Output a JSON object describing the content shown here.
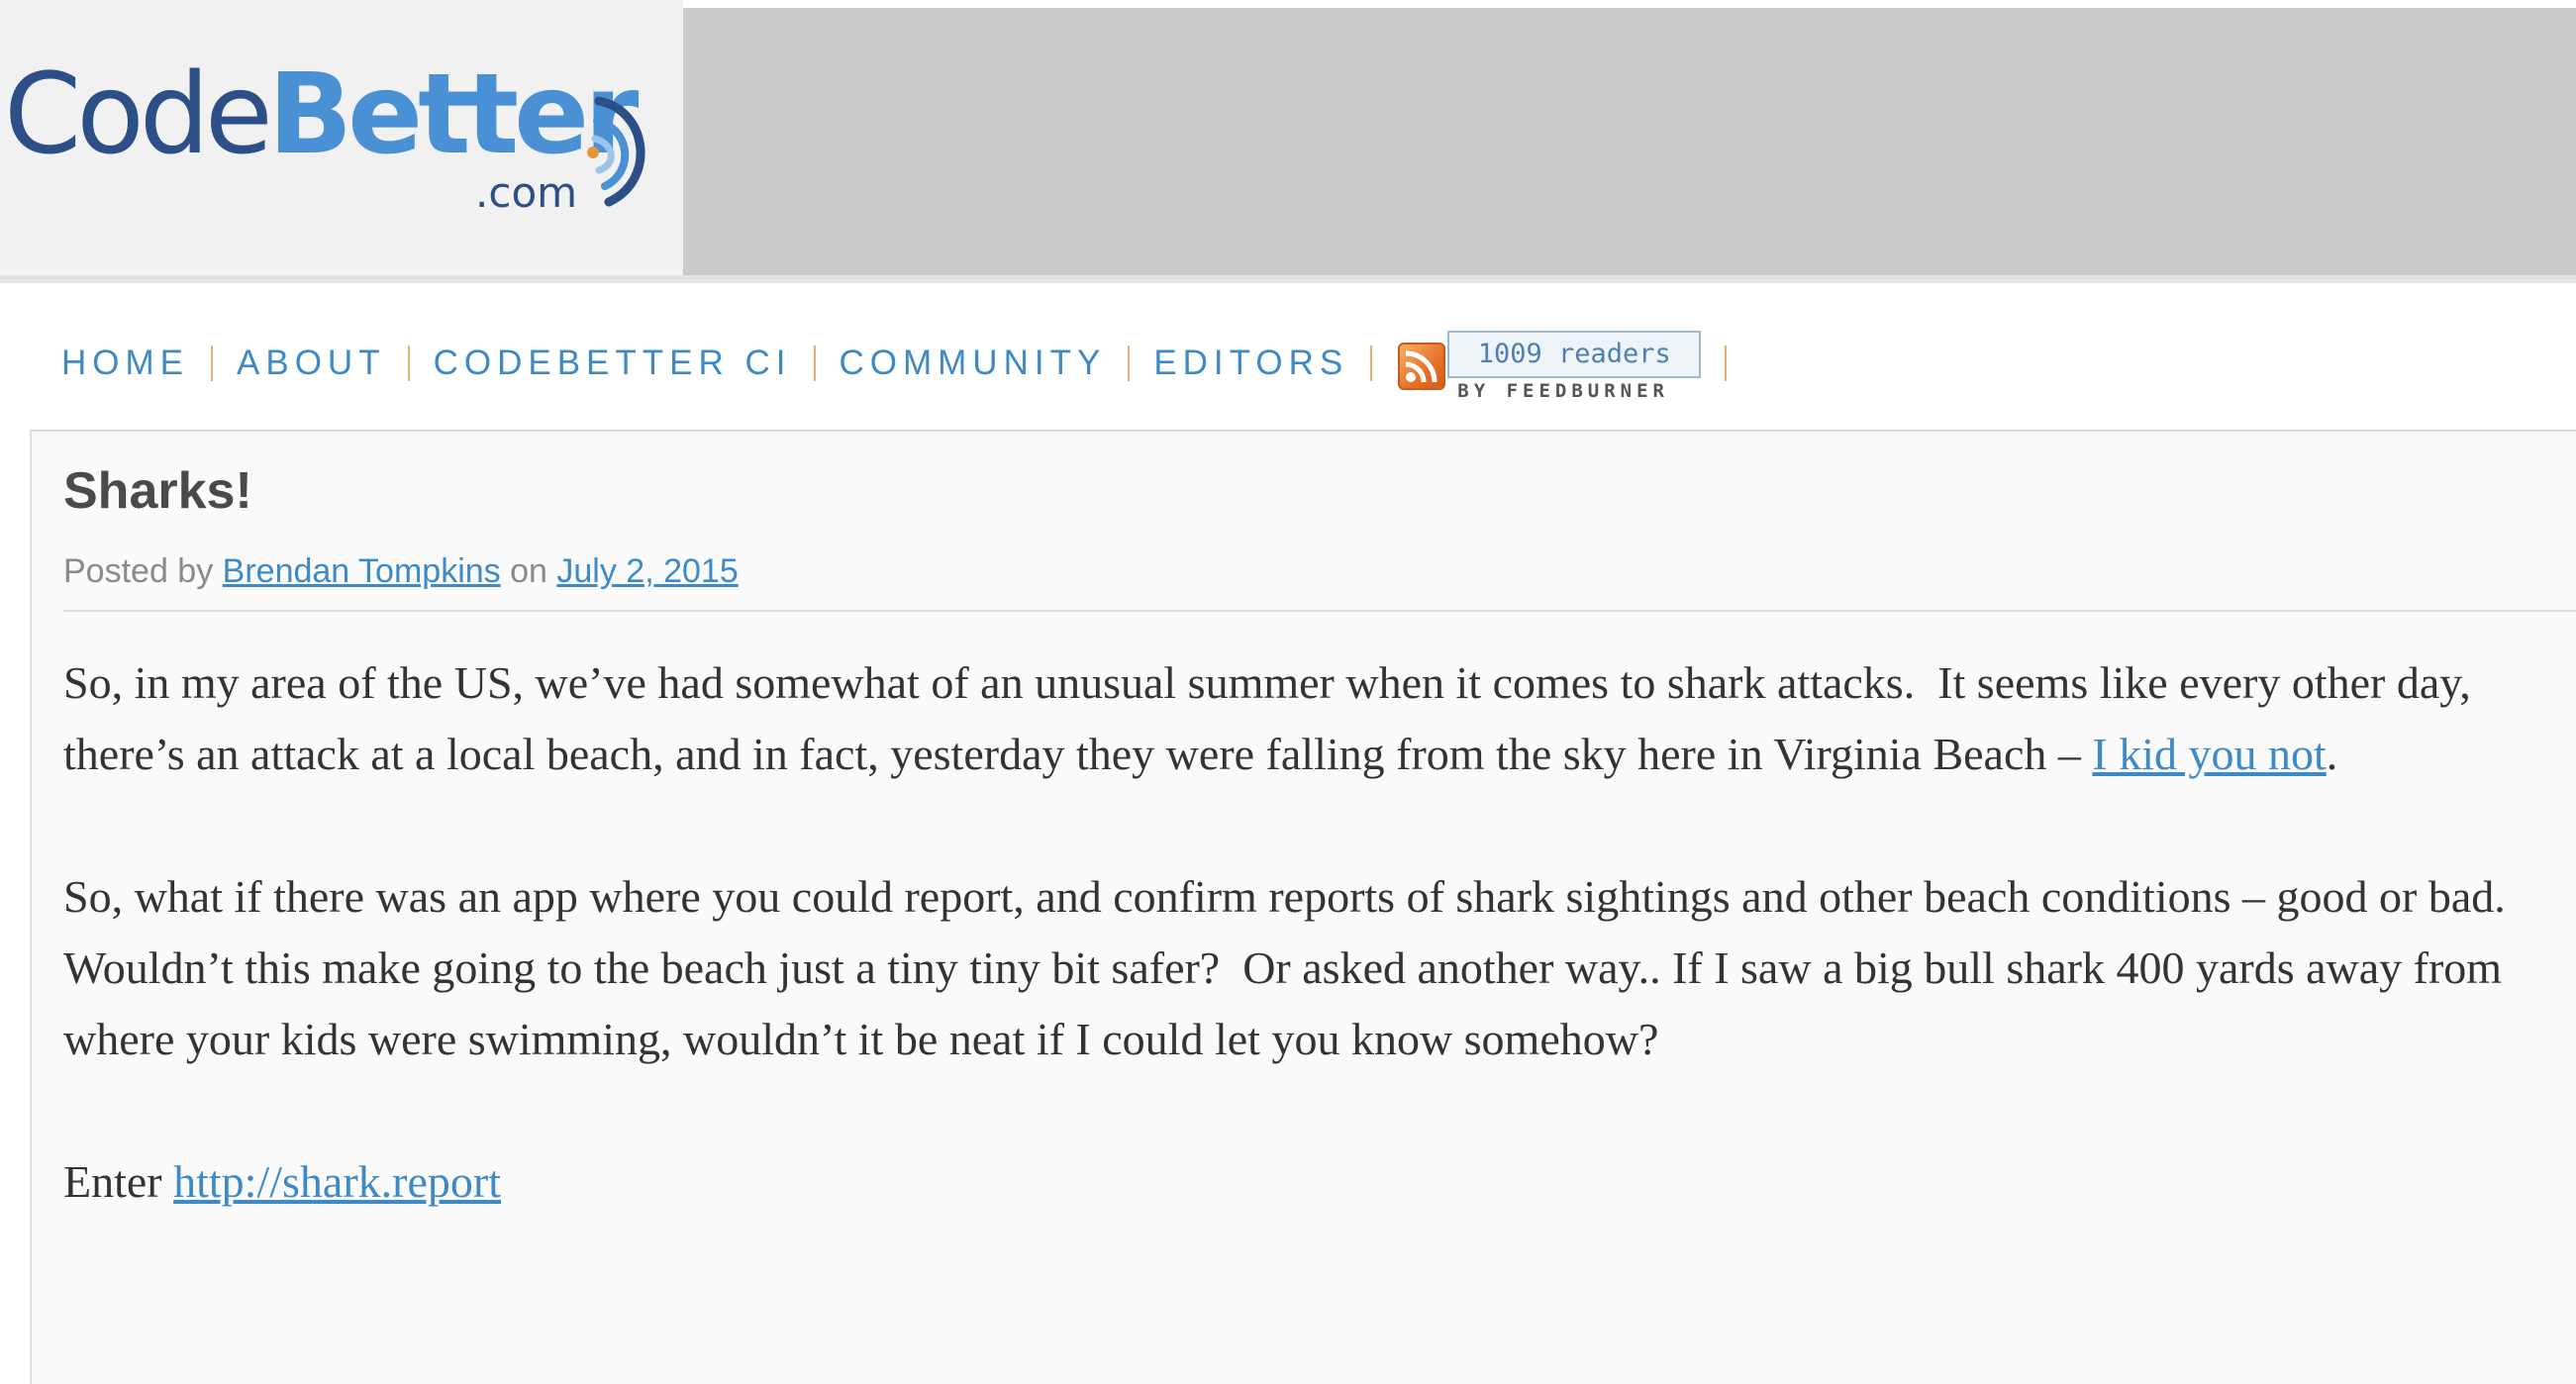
{
  "site": {
    "logo_code": "Code",
    "logo_better": "Better",
    "logo_com": ".com"
  },
  "nav": {
    "items": [
      {
        "label": "HOME"
      },
      {
        "label": "ABOUT"
      },
      {
        "label": "CODEBETTER CI"
      },
      {
        "label": "COMMUNITY"
      },
      {
        "label": "EDITORS"
      }
    ],
    "feed": {
      "icon": "rss-icon",
      "count_label": "1009 readers",
      "by_label": "BY FEEDBURNER"
    }
  },
  "post": {
    "title": "Sharks!",
    "meta": {
      "posted_by": "Posted by",
      "author": "Brendan Tompkins",
      "on": "on",
      "date": "July 2, 2015"
    },
    "paragraph1": {
      "text": "So, in my area of the US, we’ve had somewhat of an unusual summer when it comes to shark attacks.  It seems like every other day, there’s an attack at a local beach, and in fact, yesterday they were falling from the sky here in Virginia Beach – ",
      "link": "I kid you not",
      "end": "."
    },
    "paragraph2": {
      "text": "So, what if there was an app where you could report, and confirm reports of shark sightings and other beach conditions – good or bad.  Wouldn’t this make going to the beach just a tiny tiny bit safer?  Or asked another way.. If I saw a big bull shark 400 yards away from where your kids were swimming, wouldn’t it be neat if I could let you know somehow?"
    },
    "paragraph3": {
      "text": "Enter ",
      "link": "http://shark.report"
    }
  },
  "colors": {
    "link": "#3d8ac7",
    "logo_dark": "#2b4f86",
    "logo_light": "#4a90d4",
    "banner": "#cbcbcb",
    "nav_separator": "#e8b070"
  }
}
